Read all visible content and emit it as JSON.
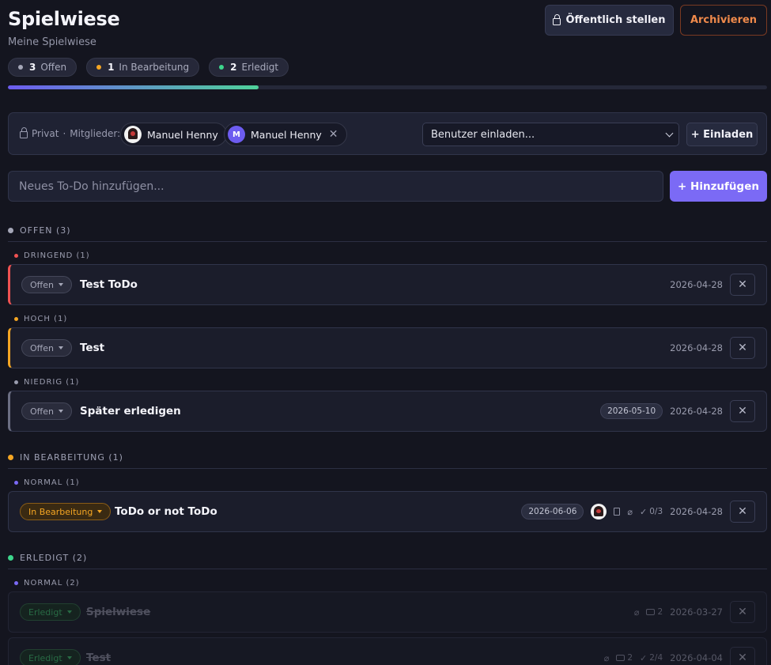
{
  "header": {
    "title": "Spielwiese",
    "subtitle": "Meine Spielwiese",
    "public_button": "Öffentlich stellen",
    "archive_button": "Archivieren"
  },
  "stats": [
    {
      "count": "3",
      "label": "Offen",
      "color": "#a5a7b8"
    },
    {
      "count": "1",
      "label": "In Bearbeitung",
      "color": "#f5a623"
    },
    {
      "count": "2",
      "label": "Erledigt",
      "color": "#3dd68c"
    }
  ],
  "progress": {
    "fraction": 0.33
  },
  "members": {
    "privacy_label": "Privat",
    "separator": "·",
    "members_label": "Mitglieder:",
    "list": [
      {
        "name": "Manuel Henny",
        "avatar": "image"
      },
      {
        "name": "Manuel Henny",
        "avatar_letter": "M"
      }
    ],
    "remove_glyph": "✕",
    "invite_placeholder": "Benutzer einladen...",
    "invite_button": "+ Einladen"
  },
  "new_todo": {
    "placeholder": "Neues To-Do hinzufügen...",
    "add_button": "+ Hinzufügen"
  },
  "groups": {
    "open": {
      "label": "OFFEN (3)",
      "color": "#a5a7b8"
    },
    "progress": {
      "label": "IN BEARBEITUNG (1)",
      "color": "#f5a623"
    },
    "done": {
      "label": "ERLEDIGT (2)",
      "color": "#3dd68c"
    }
  },
  "subgroups": {
    "dringend": {
      "label": "DRINGEND (1)",
      "color": "#f05252"
    },
    "hoch": {
      "label": "HOCH (1)",
      "color": "#f5a623"
    },
    "niedrig": {
      "label": "NIEDRIG (1)",
      "color": "#9a9cae"
    },
    "normal1": {
      "label": "NORMAL (1)",
      "color": "#7b6af5"
    },
    "normal2": {
      "label": "NORMAL (2)",
      "color": "#7b6af5"
    }
  },
  "todos": {
    "t1": {
      "status": "Offen",
      "title": "Test ToDo",
      "date": "2026-04-28",
      "accent": "#f05252"
    },
    "t2": {
      "status": "Offen",
      "title": "Test",
      "date": "2026-04-28",
      "accent": "#f5a623"
    },
    "t3": {
      "status": "Offen",
      "title": "Später erledigen",
      "due": "2026-05-10",
      "date": "2026-04-28",
      "accent": "#6b6e82"
    },
    "t4": {
      "status": "In Bearbeitung",
      "title": "ToDo or not ToDo",
      "due": "2026-06-06",
      "subtasks": "0/3",
      "date": "2026-04-28"
    },
    "t5": {
      "status": "Erledigt",
      "title": "Spielwiese",
      "comments": "2",
      "date": "2026-03-27"
    },
    "t6": {
      "status": "Erledigt",
      "title": "Test",
      "comments": "2",
      "subtasks": "2/4",
      "date": "2026-04-04"
    }
  },
  "icons": {
    "delete": "✕",
    "attachment": "paperclip-icon",
    "check": "✓"
  }
}
